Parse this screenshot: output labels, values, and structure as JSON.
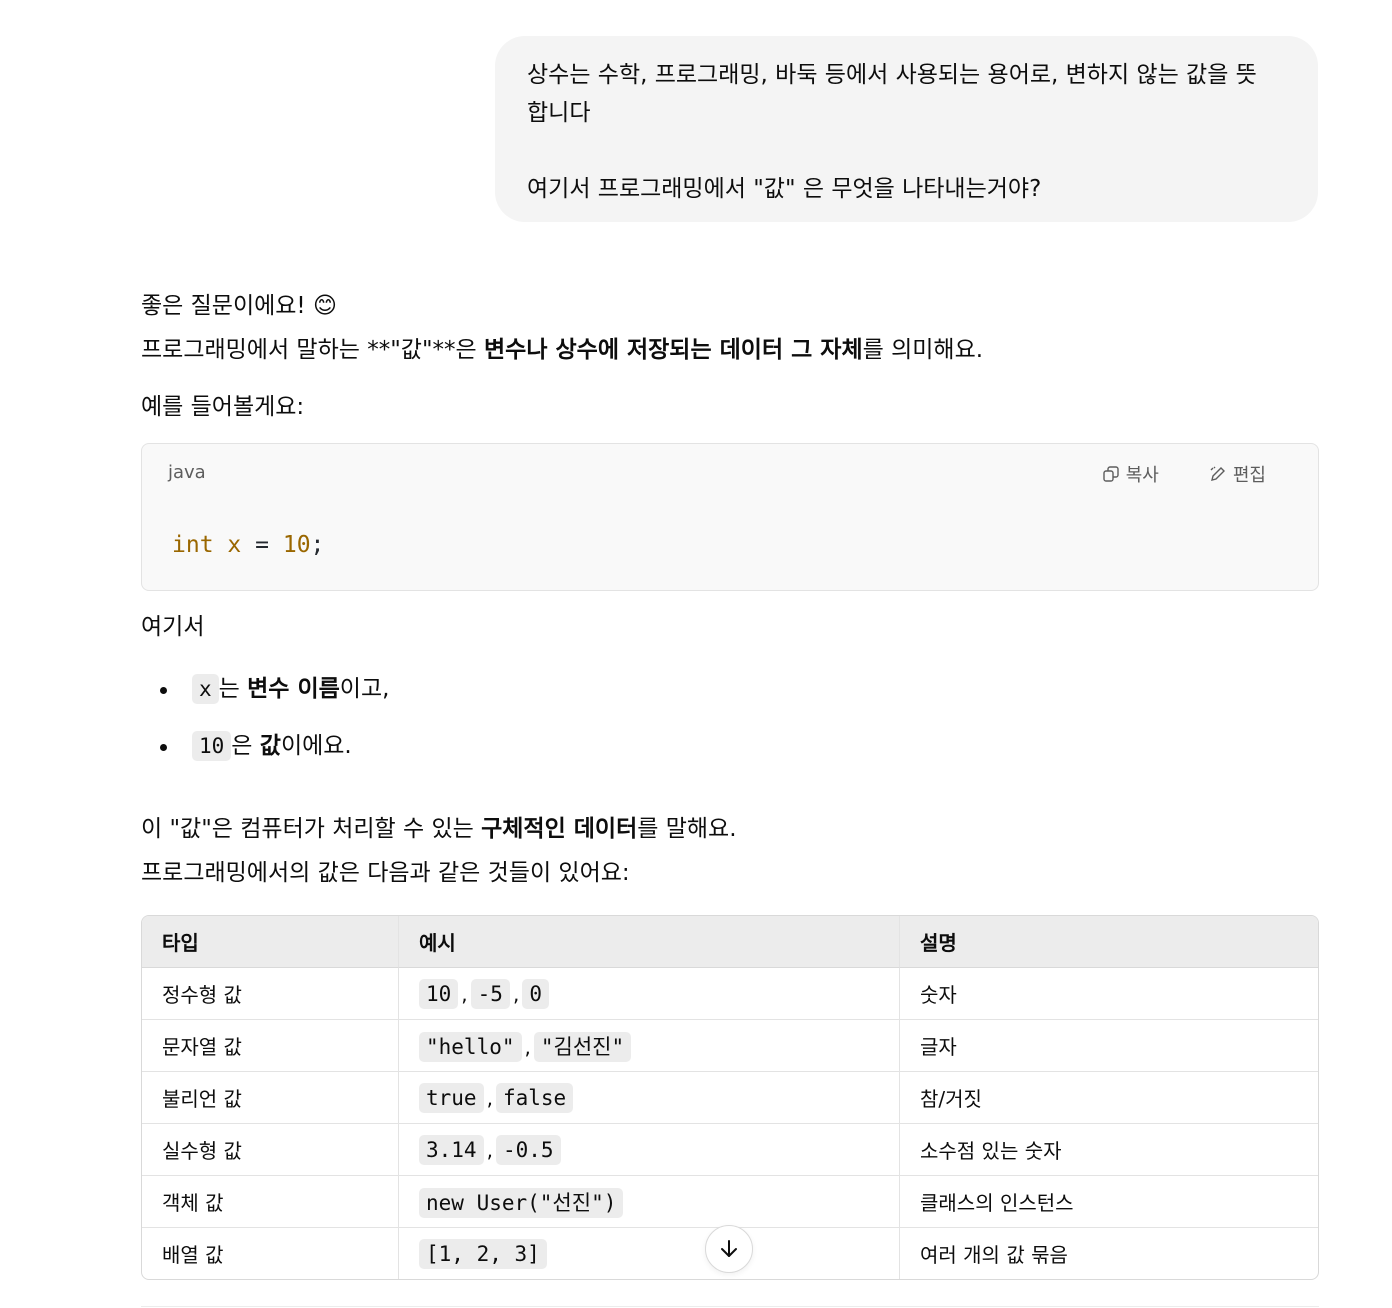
{
  "user_message": {
    "paragraph1": "상수는 수학, 프로그래밍, 바둑 등에서 사용되는 용어로, 변하지 않는 값을 뜻\n합니다",
    "paragraph2": "여기서 프로그래밍에서 \"값\" 은 무엇을 나타내는거야?"
  },
  "assistant": {
    "greeting": "좋은 질문이에요! 😊",
    "definition": {
      "prefix": "프로그래밍에서 말하는 **\"값\"**은 ",
      "bold": "변수나 상수에 저장되는 데이터 그 자체",
      "suffix": "를 의미해요."
    },
    "example_intro": "예를 들어볼게요:",
    "code_block": {
      "language": "java",
      "copy_label": "복사",
      "edit_label": "편집",
      "tokens": {
        "kw": "int",
        "var": "x",
        "eq": "=",
        "num": "10",
        "semi": ";"
      }
    },
    "here": "여기서",
    "bullets": [
      {
        "code": "x",
        "mid": "는 ",
        "bold": "변수 이름",
        "suffix": "이고,"
      },
      {
        "code": "10",
        "mid": "은 ",
        "bold": "값",
        "suffix": "이에요."
      }
    ],
    "summary": {
      "prefix": "이 \"값\"은 컴퓨터가 처리할 수 있는 ",
      "bold": "구체적인 데이터",
      "suffix": "를 말해요."
    },
    "table_intro": "프로그래밍에서의 값은 다음과 같은 것들이 있어요:",
    "table": {
      "headers": [
        "타입",
        "예시",
        "설명"
      ],
      "rows": [
        {
          "type": "정수형 값",
          "examples": [
            "10",
            "-5",
            "0"
          ],
          "desc": "숫자"
        },
        {
          "type": "문자열 값",
          "examples": [
            "\"hello\"",
            "\"김선진\""
          ],
          "desc": "글자"
        },
        {
          "type": "불리언 값",
          "examples": [
            "true",
            "false"
          ],
          "desc": "참/거짓"
        },
        {
          "type": "실수형 값",
          "examples": [
            "3.14",
            "-0.5"
          ],
          "desc": "소수점 있는 숫자"
        },
        {
          "type": "객체 값",
          "examples": [
            "new User(\"선진\")"
          ],
          "desc": "클래스의 인스턴스"
        },
        {
          "type": "배열 값",
          "examples": [
            "[1, 2, 3]"
          ],
          "desc": "여러 개의 값 묶음"
        }
      ]
    }
  },
  "icons": {
    "copy": "copy-icon",
    "edit": "edit-icon",
    "scroll": "arrow-down-icon"
  }
}
